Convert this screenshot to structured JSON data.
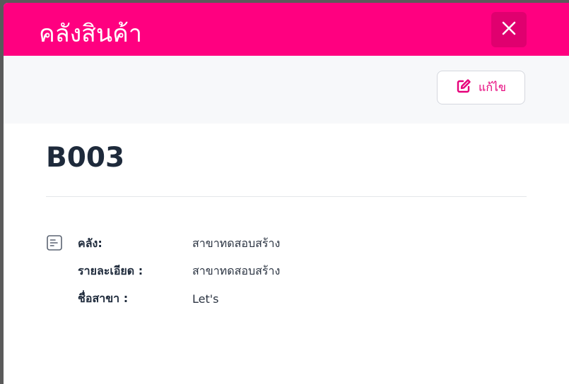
{
  "modal": {
    "title": "คลังสินค้า",
    "close_icon": "close-icon"
  },
  "toolbar": {
    "edit_label": "แก้ไข",
    "edit_icon": "edit-icon"
  },
  "record": {
    "code": "B003",
    "details_icon": "document-list-icon",
    "details": [
      {
        "label": "คลัง:",
        "value": "สาขาทดสอบสร้าง"
      },
      {
        "label": "รายละเอียด :",
        "value": "สาขาทดสอบสร้าง"
      },
      {
        "label": "ชื่อสาขา :",
        "value": "Let's"
      }
    ]
  },
  "colors": {
    "brand": "#ff0080",
    "close_button_bg": "#e0006f",
    "accent_text": "#e6007a",
    "heading_text": "#1e2a3b"
  }
}
